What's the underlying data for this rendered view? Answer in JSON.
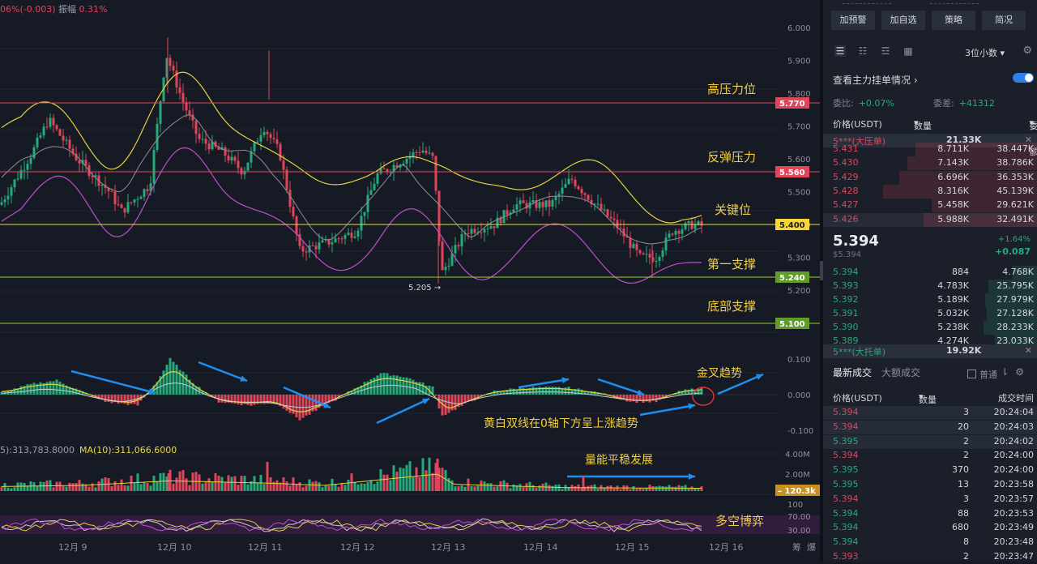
{
  "chart": {
    "info_top": {
      "change": "06%(-0.003)",
      "amp_label": "振幅",
      "amp_value": "0.31%"
    },
    "volume_label": {
      "ma5": "5):313,783.8000",
      "ma10": "MA(10):311,066.6000"
    },
    "price_axis": {
      "ticks": [
        "6.000",
        "5.900",
        "5.800",
        "5.700",
        "5.600",
        "5.500",
        "5.400",
        "5.300",
        "5.200"
      ],
      "levels": [
        "5.770",
        "5.560",
        "5.400",
        "5.240",
        "5.100"
      ]
    },
    "macd_axis": {
      "ticks": [
        "0.100",
        "0.000",
        "-0.100"
      ]
    },
    "vol_axis": {
      "ticks": [
        "4.00M",
        "2.00M"
      ],
      "current": "120.3k"
    },
    "kdj_axis": {
      "ticks": [
        "100",
        "70.00",
        "30.00"
      ]
    },
    "x_ticks": [
      "12月 9",
      "12月 10",
      "12月 11",
      "12月 12",
      "12月 13",
      "12月 14",
      "12月 15",
      "12月 16"
    ],
    "corner_labels": {
      "a": "筹",
      "b": "爆"
    },
    "low_marker": "5.205",
    "annotations": {
      "resistance_high": "高压力位",
      "rebound_pressure": "反弹压力",
      "key_level": "关键位",
      "first_support": "第一支撑",
      "bottom_support": "底部支撑",
      "golden_cross": "金叉趋势",
      "macd_note": "黄白双线在0轴下方呈上涨趋势",
      "volume_note": "量能平稳发展",
      "long_short": "多空博弈"
    },
    "colors": {
      "up": "#27a97b",
      "down": "#e0455a",
      "level_line": "#e0455a",
      "key_line": "#e8d94a",
      "support_line": "#9acd32",
      "label_text": "#f2cf3f",
      "arrow": "#1e8ff0"
    }
  },
  "panel": {
    "buttons": [
      "加预警",
      "加自选",
      "策略",
      "简况"
    ],
    "decimal": "3位小数",
    "main_force": "查看主力挂单情况",
    "ratio": {
      "label1": "委比:",
      "value1": "+0.07%",
      "label2": "委差:",
      "value2": "+41312"
    },
    "headers": {
      "price": "价格(USDT)",
      "qty": "数量 (UNI)",
      "total": "委托额"
    },
    "big_sell": {
      "name": "5***(大压单)",
      "qty": "21.33K"
    },
    "asks": [
      {
        "price": "5.431",
        "qty": "8.711K",
        "total": "38.447K"
      },
      {
        "price": "5.430",
        "qty": "7.143K",
        "total": "38.786K"
      },
      {
        "price": "5.429",
        "qty": "6.696K",
        "total": "36.353K"
      },
      {
        "price": "5.428",
        "qty": "8.316K",
        "total": "45.139K"
      },
      {
        "price": "5.427",
        "qty": "5.458K",
        "total": "29.621K"
      },
      {
        "price": "5.426",
        "qty": "5.988K",
        "total": "32.491K"
      }
    ],
    "last": {
      "price": "5.394",
      "usd": "$5.394",
      "pct": "+1.64%",
      "chg": "+0.087"
    },
    "bids": [
      {
        "price": "5.394",
        "qty": "884",
        "total": "4.768K"
      },
      {
        "price": "5.393",
        "qty": "4.783K",
        "total": "25.795K"
      },
      {
        "price": "5.392",
        "qty": "5.189K",
        "total": "27.979K"
      },
      {
        "price": "5.391",
        "qty": "5.032K",
        "total": "27.128K"
      },
      {
        "price": "5.390",
        "qty": "5.238K",
        "total": "28.233K"
      },
      {
        "price": "5.389",
        "qty": "4.274K",
        "total": "23.033K"
      }
    ],
    "big_buy": {
      "name": "5***(大托单)",
      "qty": "19.92K"
    },
    "tabs": {
      "latest": "最新成交",
      "large": "大额成交",
      "normal": "普通"
    },
    "trade_headers": {
      "price": "价格(USDT)",
      "qty": "数量(UNI)",
      "time": "成交时间"
    },
    "trades": [
      {
        "price": "5.394",
        "qty": "3",
        "time": "20:24:04",
        "side": "sell"
      },
      {
        "price": "5.394",
        "qty": "20",
        "time": "20:24:03",
        "side": "sell"
      },
      {
        "price": "5.395",
        "qty": "2",
        "time": "20:24:02",
        "side": "buy"
      },
      {
        "price": "5.394",
        "qty": "2",
        "time": "20:24:00",
        "side": "sell"
      },
      {
        "price": "5.395",
        "qty": "370",
        "time": "20:24:00",
        "side": "buy"
      },
      {
        "price": "5.395",
        "qty": "13",
        "time": "20:23:58",
        "side": "buy"
      },
      {
        "price": "5.394",
        "qty": "3",
        "time": "20:23:57",
        "side": "sell"
      },
      {
        "price": "5.394",
        "qty": "88",
        "time": "20:23:53",
        "side": "buy"
      },
      {
        "price": "5.394",
        "qty": "680",
        "time": "20:23:49",
        "side": "buy"
      },
      {
        "price": "5.394",
        "qty": "8",
        "time": "20:23:48",
        "side": "buy"
      },
      {
        "price": "5.393",
        "qty": "2",
        "time": "20:23:47",
        "side": "sell"
      }
    ]
  }
}
